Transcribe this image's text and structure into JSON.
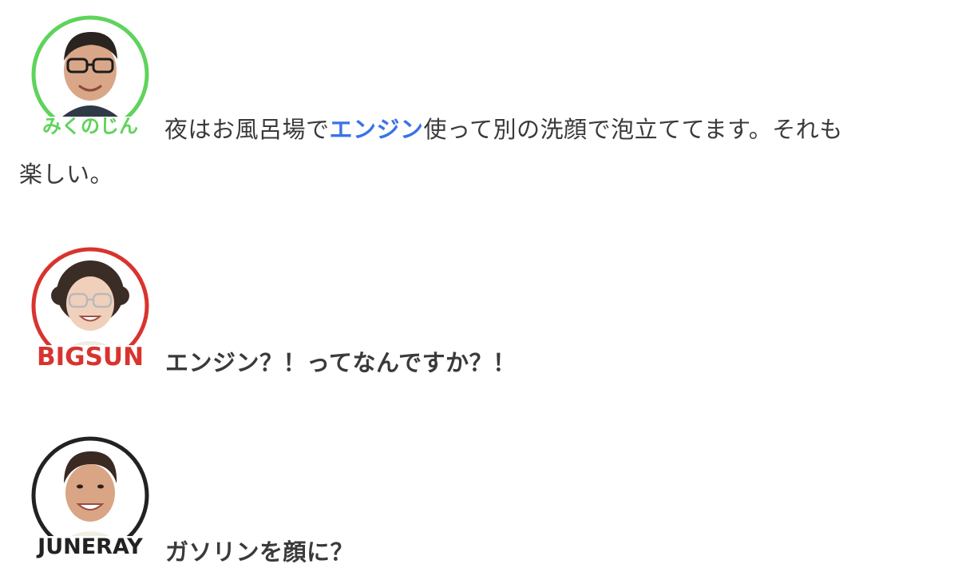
{
  "conversation": [
    {
      "speaker": "みくのじん",
      "ring_color": "#5fd35b",
      "name_color": "#5fd35b",
      "text_before": "夜はお風呂場で",
      "text_highlight": "エンジン",
      "text_after_line1": "使って別の洗顔で泡立ててます。それも",
      "text_line2": "楽しい。",
      "highlight_color": "#3b73e6"
    },
    {
      "speaker": "BIGSUN",
      "ring_color": "#d9332e",
      "name_color": "#d9332e",
      "text": "エンジン？！ってなんですか？！"
    },
    {
      "speaker": "JUNERAY",
      "ring_color": "#222222",
      "name_color": "#222222",
      "text": "ガソリンを顔に？"
    }
  ]
}
